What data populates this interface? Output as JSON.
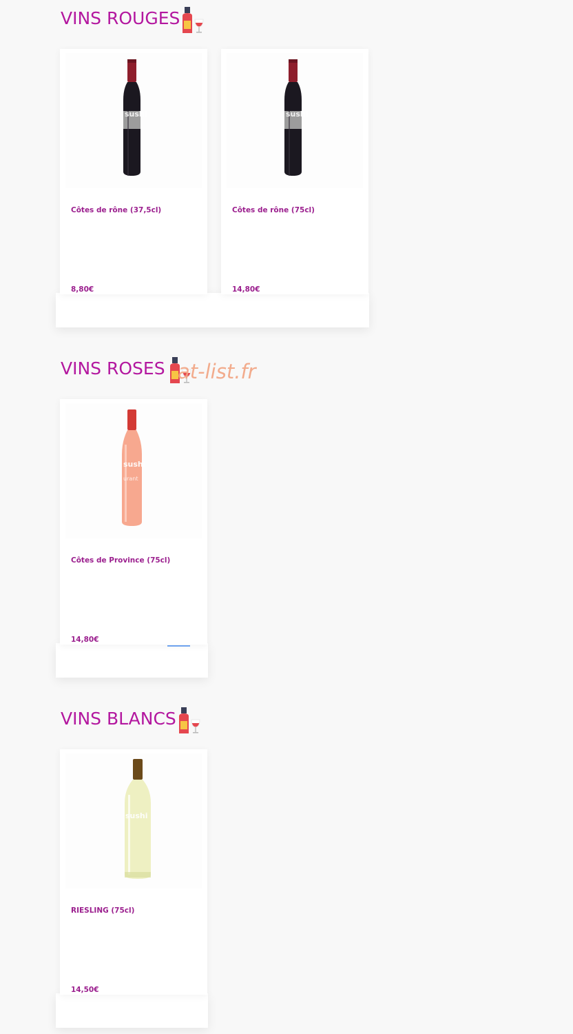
{
  "sections": [
    {
      "title": "VINS ROUGES",
      "products": [
        {
          "name": "Côtes de rône (37,5cl)",
          "price": "8,80€",
          "bottle": "red-wine-bottle"
        },
        {
          "name": "Côtes de rône (75cl)",
          "price": "14,80€",
          "bottle": "red-wine-bottle"
        }
      ]
    },
    {
      "title": "VINS ROSES",
      "products": [
        {
          "name": "Côtes de Province (75cl)",
          "price": "14,80€",
          "bottle": "rose-wine-bottle"
        }
      ]
    },
    {
      "title": "VINS BLANCS",
      "products": [
        {
          "name": "RIESLING (75cl)",
          "price": "14,50€",
          "bottle": "white-wine-bottle"
        }
      ]
    }
  ],
  "watermark": "at-list.fr",
  "colors": {
    "accent": "#b3179f",
    "product_text": "#9b1f8e",
    "background": "#f8f8f8",
    "watermark": "#f2a381",
    "link_underline": "#6fa3ef"
  }
}
